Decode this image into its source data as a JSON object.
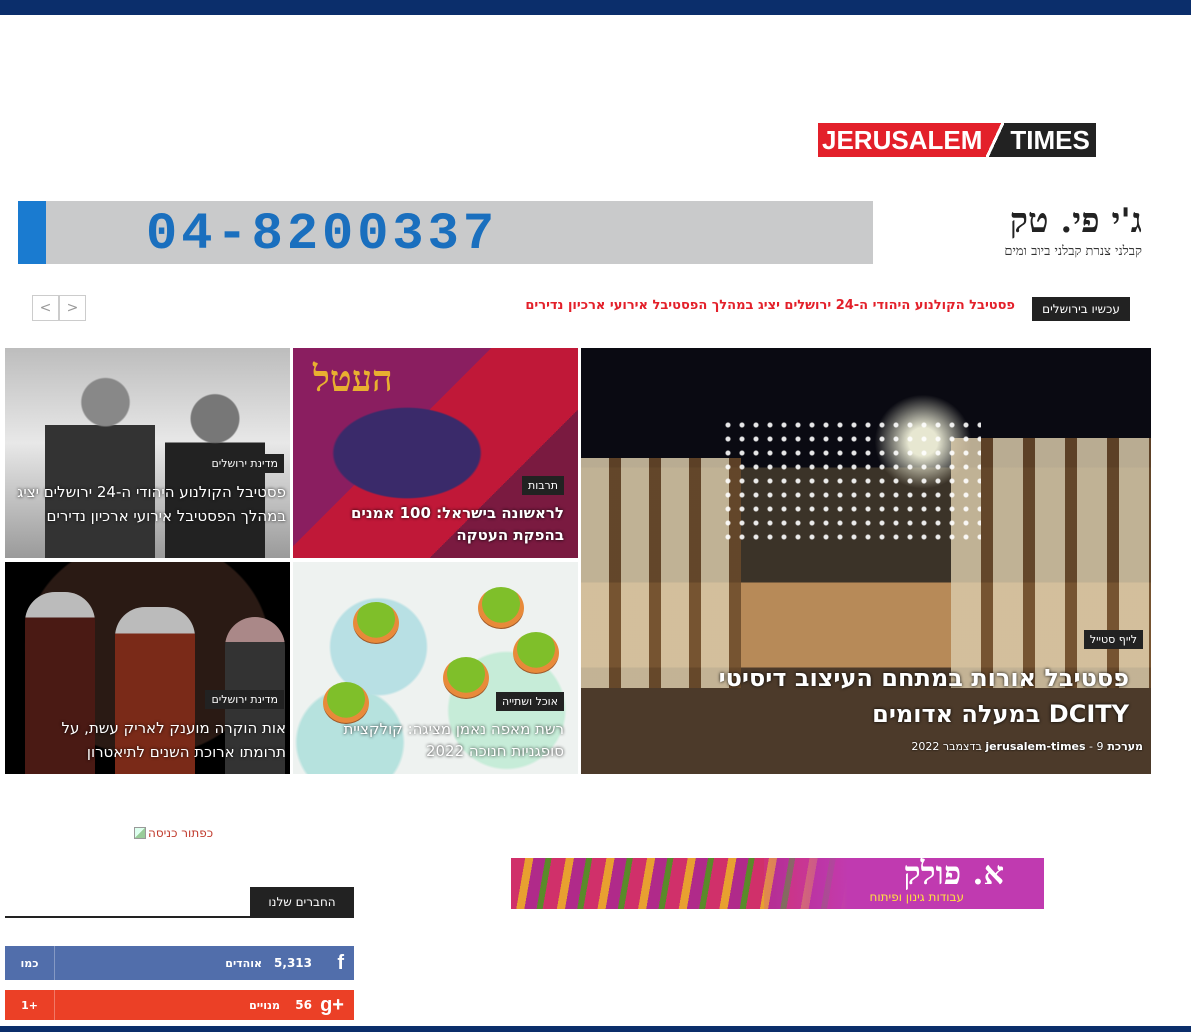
{
  "logo": {
    "part1": "JERUSALEM",
    "part2": "TIMES"
  },
  "banner_ad": {
    "phone": "04-8200337",
    "brand": "ג'י פי. טק",
    "tagline": "קבלני צנרת   קבלני ביוב ומים"
  },
  "ticker": {
    "label": "עכשיו בירושלים",
    "headline": "פסטיבל הקולנוע היהודי ה-24 ירושלים יציג במהלך הפסטיבל אירועי ארכיון נדירים",
    "prev": "<",
    "next": ">"
  },
  "tiles": {
    "main": {
      "category": "לייף סטייל",
      "headline": "פסטיבל אורות במתחם העיצוב דיסיטי DCITY במעלה אדומים",
      "author": "מערכת jerusalem-times",
      "date": "9 בדצמבר 2022"
    },
    "culture": {
      "category": "תרבות",
      "headline": "לראשונה בישראל: 100 אמנים בהפקת העטקה",
      "art": "העטל"
    },
    "film": {
      "category": "מדינת ירושלים",
      "headline": "פסטיבל הקולנוע היהודי ה-24 ירושלים יציג במהלך הפסטיבל אירועי ארכיון נדירים"
    },
    "food": {
      "category": "אוכל ושתייה",
      "headline": "רשת מאפה נאמן מציגה: קולקציית סופגניות חנוכה 2022"
    },
    "theater": {
      "category": "מדינת ירושלים",
      "headline": "אות הוקרה מוענק לאריק עשת, על תרומתו ארוכת השנים לתיאטרון"
    }
  },
  "entry_image_alt": "כפתור כניסה",
  "ad2": {
    "name": "א. פולק",
    "sub": "עבודות גינון ופיתוח"
  },
  "friends": {
    "title": "החברים שלנו",
    "facebook": {
      "icon": "f",
      "count": "5,313",
      "label": "אוהדים",
      "button": "כמו"
    },
    "googleplus": {
      "icon": "g+",
      "count": "56",
      "label": "מנויים",
      "button": "1+"
    }
  },
  "colors": {
    "brand_red": "#e3202a",
    "navy": "#0b2e6b",
    "facebook": "#516eab",
    "googleplus": "#eb4026"
  }
}
